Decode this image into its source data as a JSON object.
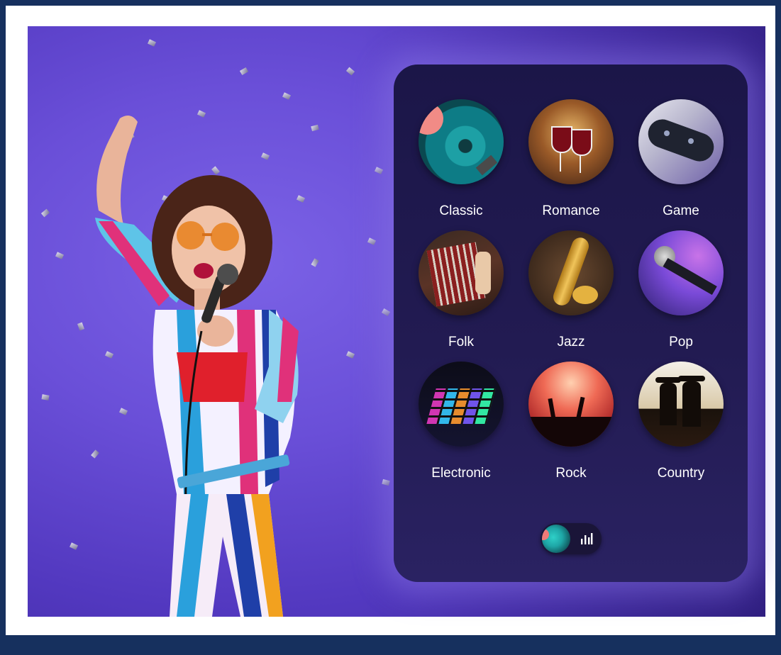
{
  "genres": [
    {
      "label": "Classic",
      "icon": "vinyl-record-icon"
    },
    {
      "label": "Romance",
      "icon": "wine-glasses-icon"
    },
    {
      "label": "Game",
      "icon": "gamepad-icon"
    },
    {
      "label": "Folk",
      "icon": "accordion-icon"
    },
    {
      "label": "Jazz",
      "icon": "saxophone-icon"
    },
    {
      "label": "Pop",
      "icon": "microphone-icon"
    },
    {
      "label": "Electronic",
      "icon": "launchpad-icon"
    },
    {
      "label": "Rock",
      "icon": "concert-crowd-icon"
    },
    {
      "label": "Country",
      "icon": "country-band-icon"
    }
  ],
  "player": {
    "thumb_icon": "now-playing-thumbnail",
    "eq_icon": "equalizer-icon"
  },
  "colors": {
    "page_border": "#16305e",
    "hero_purple": "#6a4fd8",
    "panel_bg": "#1f1a4e",
    "label_text": "#ffffff"
  }
}
